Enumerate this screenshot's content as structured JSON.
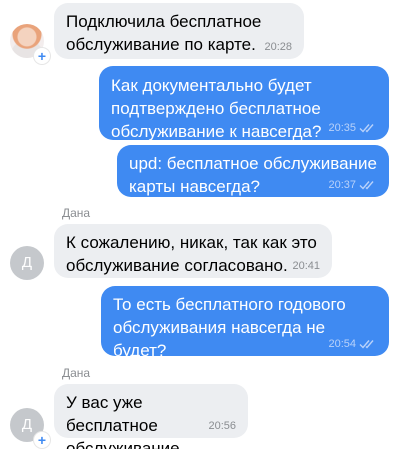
{
  "messages": [
    {
      "direction": "incoming",
      "lines": [
        "Подключила бесплатное",
        "обслуживание по карте."
      ],
      "time": "20:28",
      "avatar": {
        "type": "photo"
      }
    },
    {
      "direction": "outgoing",
      "lines": [
        "Как документально будет",
        "подтверждено бесплатное",
        "обслуживание к навсегда?"
      ],
      "time": "20:35",
      "read": true
    },
    {
      "direction": "outgoing",
      "lines": [
        "upd: бесплатное обслуживание",
        "карты навсегда?"
      ],
      "time": "20:37",
      "read": true
    },
    {
      "direction": "incoming",
      "sender": "Дана",
      "lines": [
        "К сожалению, никак, так как это",
        "обслуживание согласовано."
      ],
      "time": "20:41",
      "avatar": {
        "type": "letter",
        "letter": "Д"
      }
    },
    {
      "direction": "outgoing",
      "lines": [
        "То есть бесплатного годового",
        "обслуживания навсегда не будет?"
      ],
      "time": "20:54",
      "read": true
    },
    {
      "direction": "incoming",
      "sender": "Дана",
      "lines": [
        "У вас уже бесплатное",
        "обслуживание."
      ],
      "time": "20:56",
      "avatar": {
        "type": "letter",
        "letter": "Д"
      }
    }
  ],
  "badge_symbol": "+",
  "colors": {
    "incoming_bubble": "#eceef1",
    "outgoing_bubble": "#3f8af2",
    "meta_gray": "#8a8d91",
    "avatar_gray": "#c5c8cc"
  },
  "icons": [
    "read-double-check-icon",
    "plus-badge-icon"
  ]
}
